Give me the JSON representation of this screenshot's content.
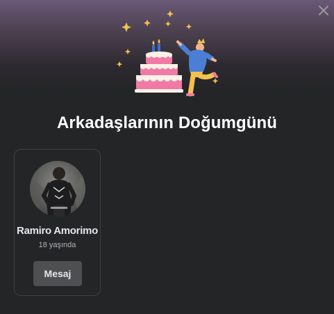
{
  "dialog": {
    "title": "Arkadaşlarının Doğumgünü",
    "close_icon": "close-icon",
    "illustration_icon": "birthday-cake-celebration-illustration"
  },
  "birthdays": [
    {
      "name": "Ramiro Amorimo",
      "age_text": "18 yaşında",
      "message_label": "Mesaj"
    }
  ],
  "colors": {
    "background": "#242526",
    "header_gradient_top": "#6a5878",
    "button_bg": "#4e4f50",
    "cake_pink": "#f07aa5",
    "text_primary": "#ffffff",
    "text_secondary": "#b0b3b8"
  }
}
